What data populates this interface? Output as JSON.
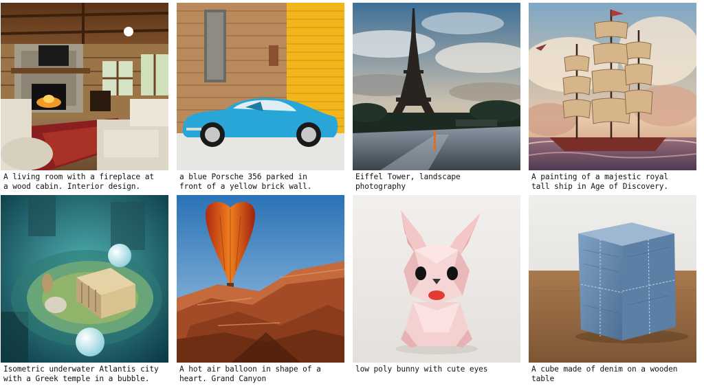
{
  "gallery": {
    "items": [
      {
        "caption": "A living room with a fireplace at\na wood cabin. Interior design."
      },
      {
        "caption": "a blue Porsche 356 parked in\nfront of a yellow brick wall."
      },
      {
        "caption": "Eiffel Tower, landscape\nphotography"
      },
      {
        "caption": "A painting of a majestic royal\ntall ship in Age of Discovery."
      },
      {
        "caption": "Isometric underwater Atlantis city\nwith a Greek temple in a bubble."
      },
      {
        "caption": "A hot air balloon in shape of a\nheart. Grand Canyon"
      },
      {
        "caption": "low poly bunny with cute eyes"
      },
      {
        "caption": "A cube made of denim on a wooden\ntable"
      }
    ]
  }
}
